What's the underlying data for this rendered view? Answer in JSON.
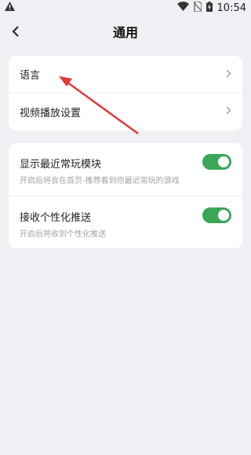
{
  "status_bar": {
    "time": "10:54",
    "left_icon": "warning-icon",
    "icons": [
      "wifi-icon",
      "no-sim-icon",
      "battery-charging-icon"
    ]
  },
  "header": {
    "title": "通用",
    "back_icon": "back-chevron-icon"
  },
  "nav_items": [
    {
      "label": "语言"
    },
    {
      "label": "视频播放设置"
    }
  ],
  "toggles": [
    {
      "title": "显示最近常玩模块",
      "subtitle": "开启后将会在首页-推荐看到你最近常玩的游戏",
      "enabled": true
    },
    {
      "title": "接收个性化推送",
      "subtitle": "开启后将收到个性化推送",
      "enabled": true
    }
  ],
  "colors": {
    "accent": "#3aa657",
    "annotation": "#e0393c",
    "background": "#eef0f3"
  }
}
